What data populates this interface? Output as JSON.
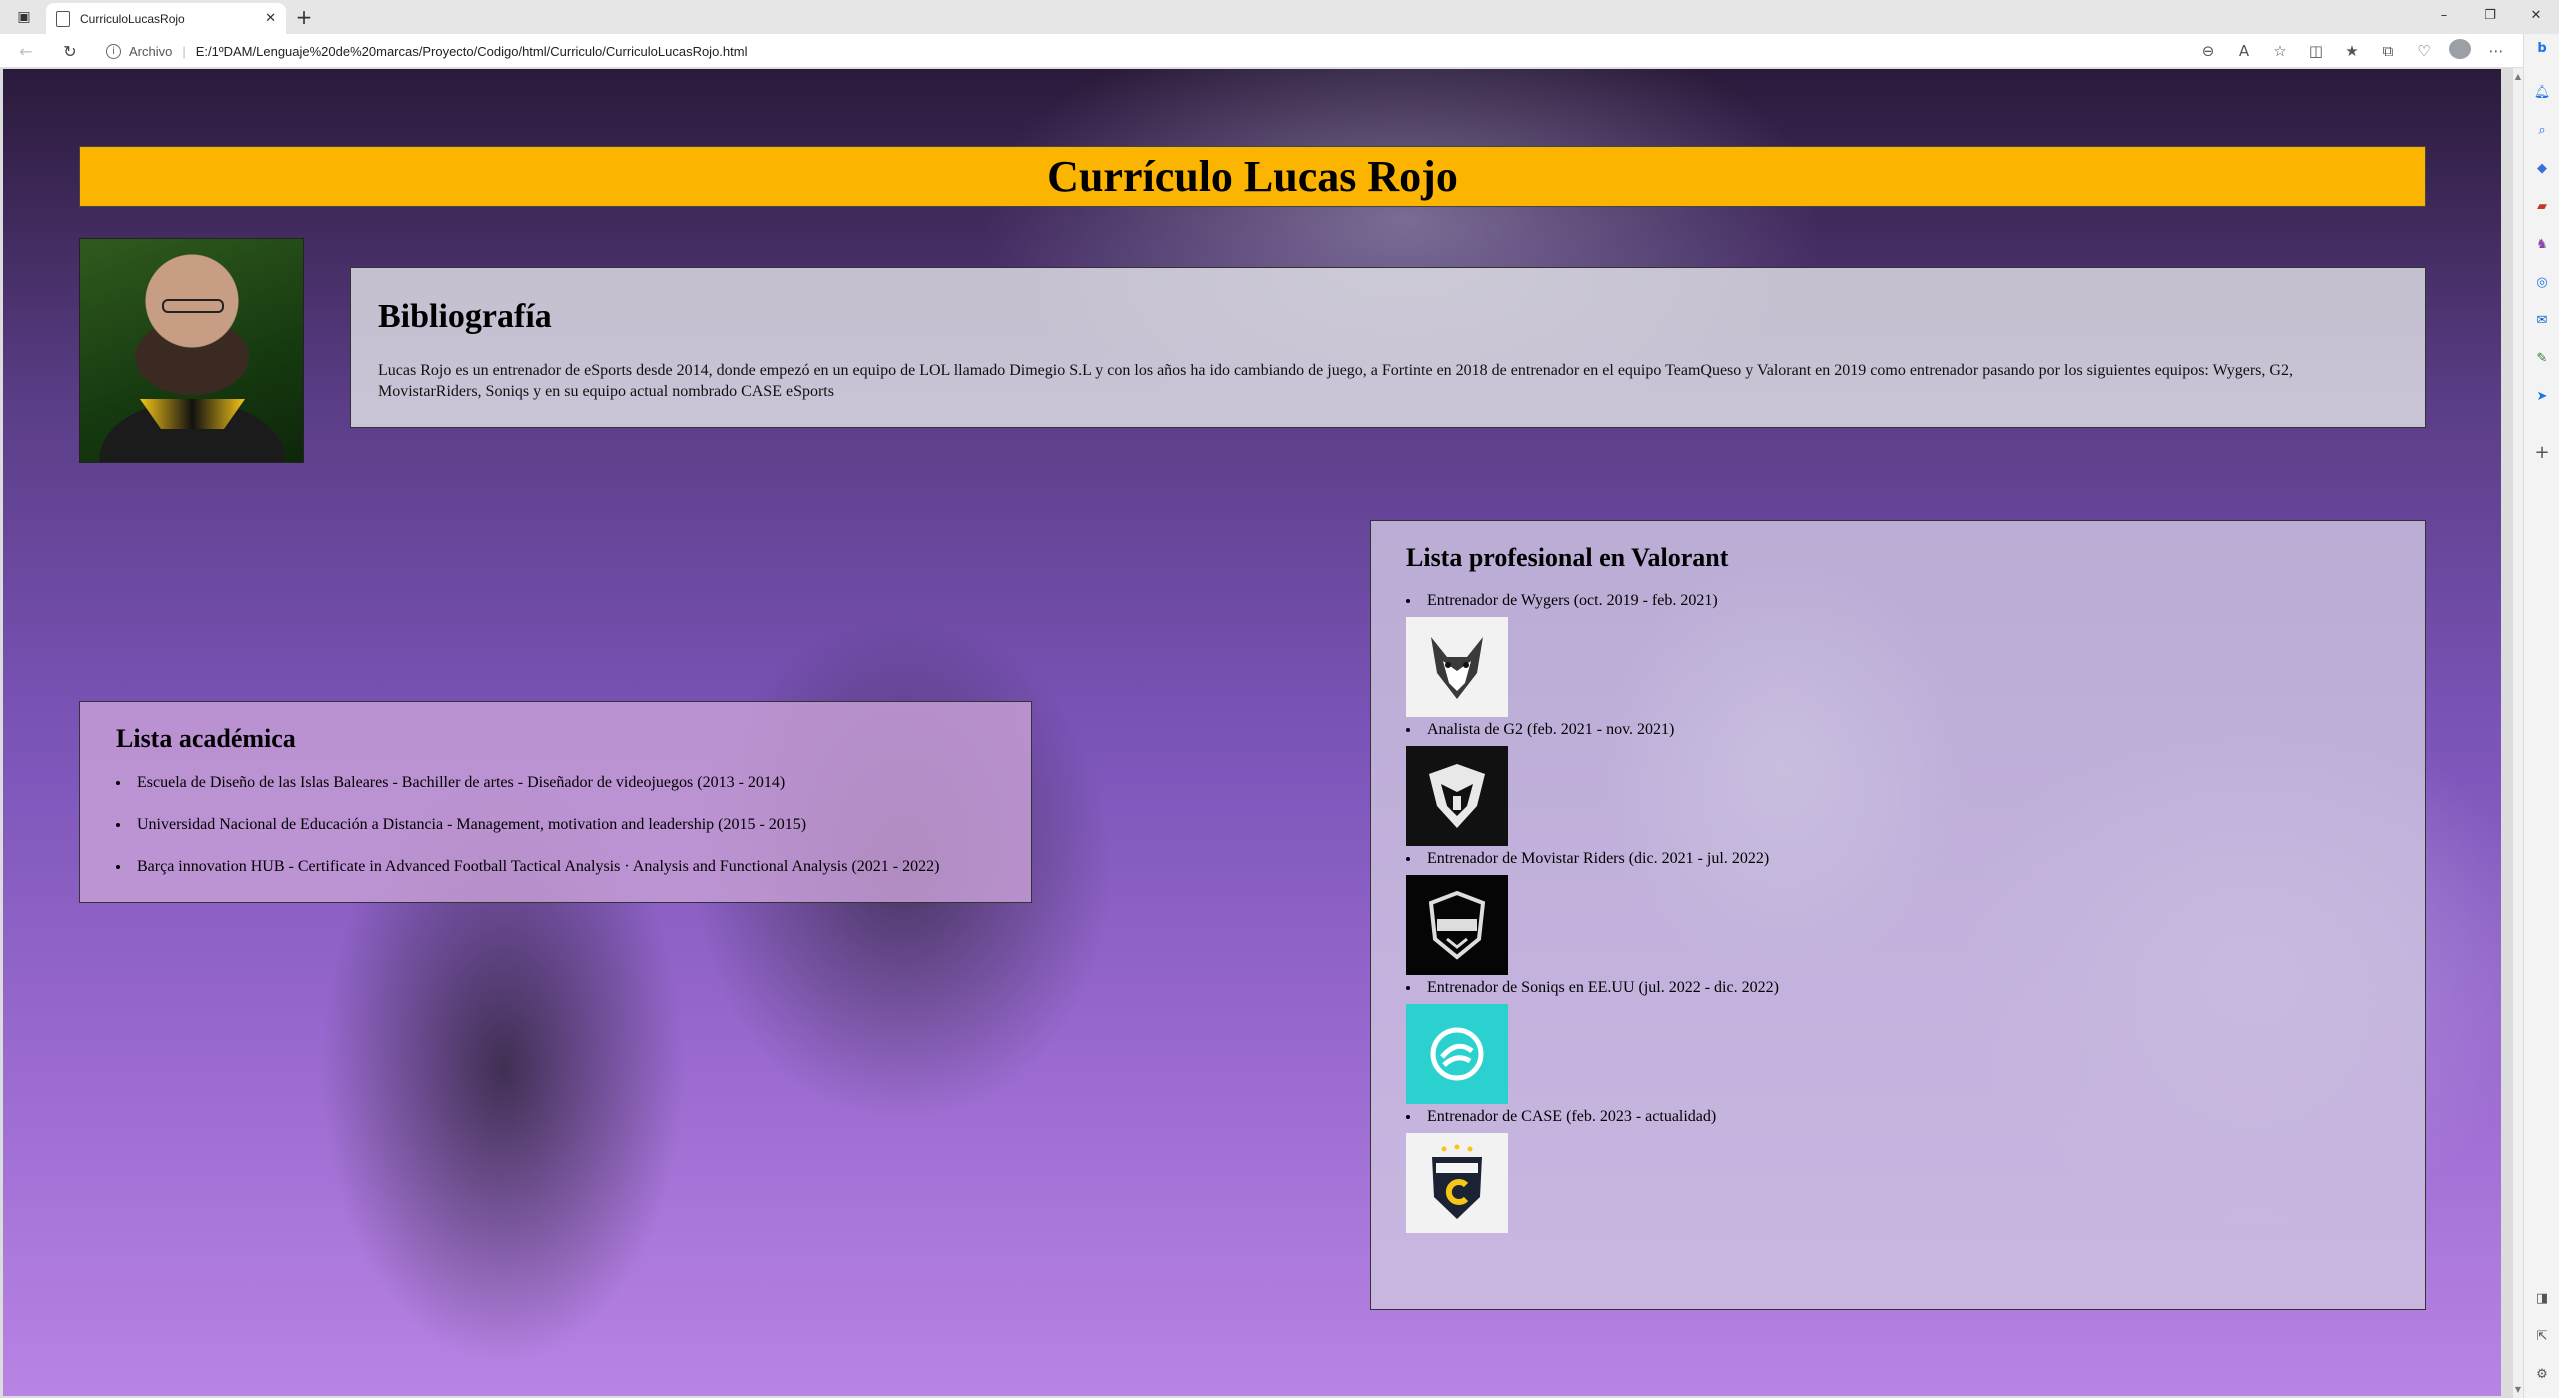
{
  "browser": {
    "tab_title": "CurriculoLucasRojo",
    "url_scheme_label": "Archivo",
    "url": "E:/1ºDAM/Lenguaje%20de%20marcas/Proyecto/Codigo/html/Curriculo/CurriculoLucasRojo.html"
  },
  "page": {
    "title": "Currículo Lucas Rojo",
    "bio": {
      "heading": "Bibliografía",
      "text": "Lucas Rojo es un entrenador de eSports desde 2014, donde empezó en un equipo de LOL llamado Dimegio S.L y con los años ha ido cambiando de juego, a Fortinte en 2018 de entrenador en el equipo TeamQueso y Valorant en 2019 como entrenador pasando por los siguientes equipos: Wygers, G2, MovistarRiders, Soniqs y en su equipo actual nombrado CASE eSports"
    },
    "academic": {
      "heading": "Lista académica",
      "items": [
        "Escuela de Diseño de las Islas Baleares - Bachiller de artes - Diseñador de videojuegos (2013 - 2014)",
        "Universidad Nacional de Educación a Distancia - Management, motivation and leadership (2015 - 2015)",
        "Barça innovation HUB - Certificate in Advanced Football Tactical Analysis · Analysis and Functional Analysis (2021 - 2022)"
      ]
    },
    "professional": {
      "heading": "Lista profesional en Valorant",
      "items": [
        {
          "text": "Entrenador de Wygers (oct. 2019 - feb. 2021)",
          "logo": "wygers-logo"
        },
        {
          "text": "Analista de G2 (feb. 2021 - nov. 2021)",
          "logo": "g2-logo"
        },
        {
          "text": "Entrenador de Movistar Riders (dic. 2021 - jul. 2022)",
          "logo": "movistar-riders-logo"
        },
        {
          "text": "Entrenador de Soniqs en EE.UU (jul. 2022 - dic. 2022)",
          "logo": "soniqs-logo"
        },
        {
          "text": "Entrenador de CASE (feb. 2023 - actualidad)",
          "logo": "case-esports-logo"
        }
      ]
    }
  }
}
